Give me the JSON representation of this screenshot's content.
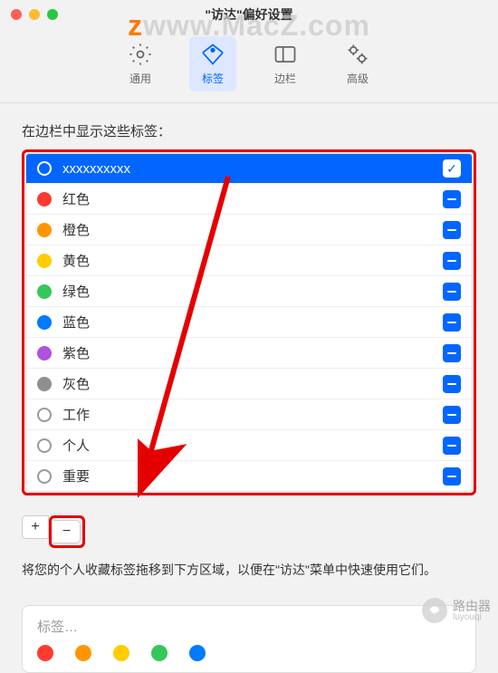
{
  "window": {
    "title": "\"访达\"偏好设置"
  },
  "watermark": {
    "prefix": "z",
    "text": "www.MacZ.com"
  },
  "side_watermark": {
    "name": "路由器",
    "sub": "luyouqi"
  },
  "toolbar": {
    "general": "通用",
    "tags": "标签",
    "sidebar": "边栏",
    "advanced": "高级"
  },
  "section_label": "在边栏中显示这些标签：",
  "tags": [
    {
      "name": "xxxxxxxxxx",
      "color": "",
      "selected": true,
      "state": "check"
    },
    {
      "name": "红色",
      "color": "#ff3b30",
      "state": "dash"
    },
    {
      "name": "橙色",
      "color": "#ff9500",
      "state": "dash"
    },
    {
      "name": "黄色",
      "color": "#ffcc00",
      "state": "dash"
    },
    {
      "name": "绿色",
      "color": "#34c759",
      "state": "dash"
    },
    {
      "name": "蓝色",
      "color": "#007aff",
      "state": "dash"
    },
    {
      "name": "紫色",
      "color": "#af52de",
      "state": "dash"
    },
    {
      "name": "灰色",
      "color": "#8e8e93",
      "state": "dash"
    },
    {
      "name": "工作",
      "color": "",
      "state": "dash"
    },
    {
      "name": "个人",
      "color": "",
      "state": "dash"
    },
    {
      "name": "重要",
      "color": "",
      "state": "dash"
    }
  ],
  "buttons": {
    "add": "+",
    "remove": "−"
  },
  "help_text": "将您的个人收藏标签拖移到下方区域，以便在\"访达\"菜单中快速使用它们。",
  "fav": {
    "label": "标签…",
    "colors": [
      "#ff3b30",
      "#ff9500",
      "#ffcc00",
      "#34c759",
      "#007aff"
    ]
  }
}
